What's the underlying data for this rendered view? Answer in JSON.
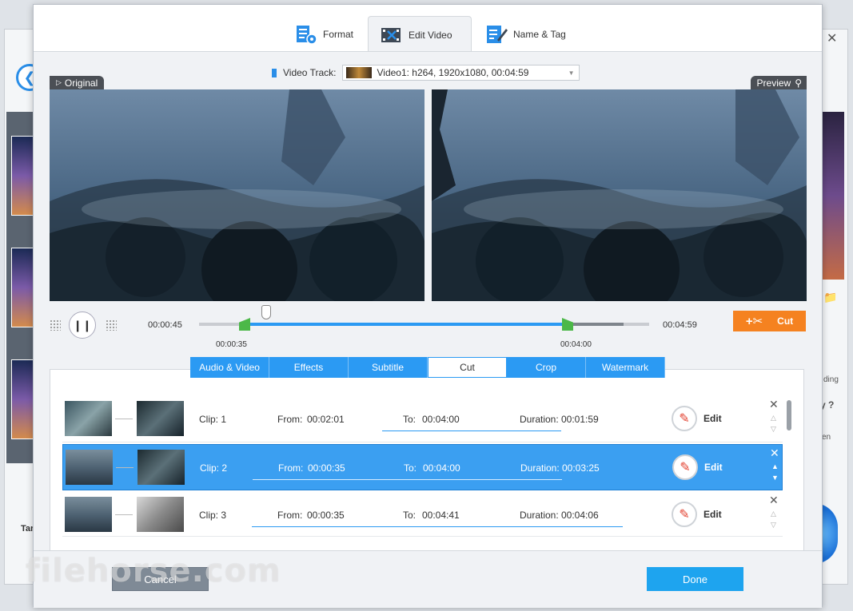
{
  "tabs": [
    {
      "label": "Format",
      "icon": "format-icon"
    },
    {
      "label": "Edit Video",
      "icon": "edit-video-icon",
      "active": true
    },
    {
      "label": "Name & Tag",
      "icon": "name-tag-icon"
    }
  ],
  "video": {
    "original_label": "Original",
    "preview_label": "Preview",
    "track_label": "Video Track:",
    "track_value": "Video1: h264, 1920x1080, 00:04:59"
  },
  "timeline": {
    "current": "00:00:45",
    "total": "00:04:59",
    "start_marker": "00:00:35",
    "end_marker": "00:04:00",
    "cut_label": "Cut"
  },
  "subtabs": [
    "Audio & Video",
    "Effects",
    "Subtitle",
    "Cut",
    "Crop",
    "Watermark"
  ],
  "active_subtab": "Cut",
  "clips": [
    {
      "clip": "Clip: 1",
      "from_label": "From:",
      "from": "00:02:01",
      "to_label": "To:",
      "to": "00:04:00",
      "duration_label": "Duration:",
      "duration": "00:01:59",
      "edit": "Edit"
    },
    {
      "clip": "Clip: 2",
      "from_label": "From:",
      "from": "00:00:35",
      "to_label": "To:",
      "to": "00:04:00",
      "duration_label": "Duration:",
      "duration": "00:03:25",
      "edit": "Edit"
    },
    {
      "clip": "Clip: 3",
      "from_label": "From:",
      "from": "00:00:35",
      "to_label": "To:",
      "to": "00:04:41",
      "duration_label": "Duration:",
      "duration": "00:04:06",
      "edit": "Edit"
    }
  ],
  "footer": {
    "cancel": "Cancel",
    "done": "Done"
  },
  "background": {
    "left_label": "Tar",
    "right_1": "ding",
    "right_2": "y ?",
    "right_3": "en"
  },
  "watermark": "filehorse.com",
  "colors": {
    "accent": "#2b9af3",
    "cut": "#f58220",
    "done": "#1ea4ef",
    "marker": "#4cb848"
  }
}
